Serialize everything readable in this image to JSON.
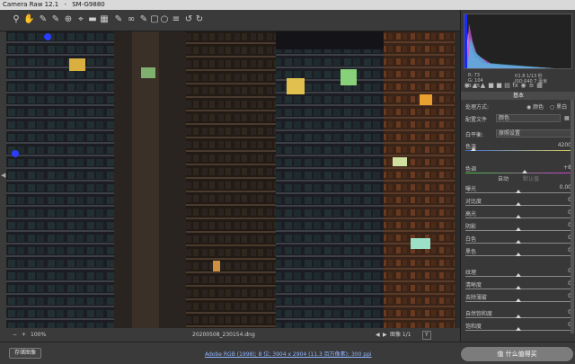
{
  "window": {
    "title": "Camera Raw 12.1",
    "separator": "-",
    "camera": "SM-G9880"
  },
  "toolbar": {
    "tools": [
      "zoom-icon",
      "hand-icon",
      "white-balance-icon",
      "color-sampler-icon",
      "targeted-adjust-icon",
      "crop-icon",
      "straighten-icon",
      "transform-icon",
      "spot-removal-icon",
      "red-eye-icon",
      "adjustment-brush-icon",
      "graduated-filter-icon",
      "radial-filter-icon",
      "preferences-icon",
      "rotate-left-icon",
      "rotate-right-icon"
    ]
  },
  "panel": {
    "histogram_info": {
      "r_label": "R:",
      "r_val": "73",
      "g_label": "G:",
      "g_val": "104",
      "b_label": "B:",
      "b_val": "35",
      "exposure": "f/1.8 1/13 秒",
      "iso": "ISO 640 7 毫米"
    },
    "section": "基本",
    "process": {
      "label": "处理方式:",
      "opt1": "颜色",
      "opt2": "黑白"
    },
    "profile": {
      "label": "配置文件",
      "value": "颜色"
    },
    "wb": {
      "label": "白平衡:",
      "value": "原照设置"
    },
    "temp": {
      "label": "色温",
      "value": "4200"
    },
    "tint": {
      "label": "色调",
      "value": "+8"
    },
    "auto": "自动",
    "default": "默认值",
    "sliders": [
      {
        "label": "曝光",
        "value": "0.00",
        "level": 0.5
      },
      {
        "label": "对比度",
        "value": "0",
        "level": 0.5
      },
      {
        "label": "高光",
        "value": "0",
        "level": 0.5
      },
      {
        "label": "阴影",
        "value": "0",
        "level": 0.5
      },
      {
        "label": "白色",
        "value": "0",
        "level": 0.5
      },
      {
        "label": "黑色",
        "value": "0",
        "level": 0.5
      },
      {
        "label": "纹理",
        "value": "0",
        "level": 0.5
      },
      {
        "label": "清晰度",
        "value": "0",
        "level": 0.5
      },
      {
        "label": "去除薄雾",
        "value": "0",
        "level": 0.5
      },
      {
        "label": "自然饱和度",
        "value": "0",
        "level": 0.5
      },
      {
        "label": "饱和度",
        "value": "0",
        "level": 0.5
      }
    ]
  },
  "status": {
    "zoom": "100%",
    "filename": "20200508_230154.dng",
    "nav": "图像 1/1"
  },
  "bottom": {
    "save": "存储图像",
    "workflow": "Adobe RGB (1998); 8 位; 3904 x 2904 (11.3 百万像素); 300 ppi",
    "watermark": "值 什么值得买"
  },
  "colors": {
    "panel": "#383838",
    "accent": "#8fb4ff",
    "title_bar": "#d9d9d9"
  }
}
